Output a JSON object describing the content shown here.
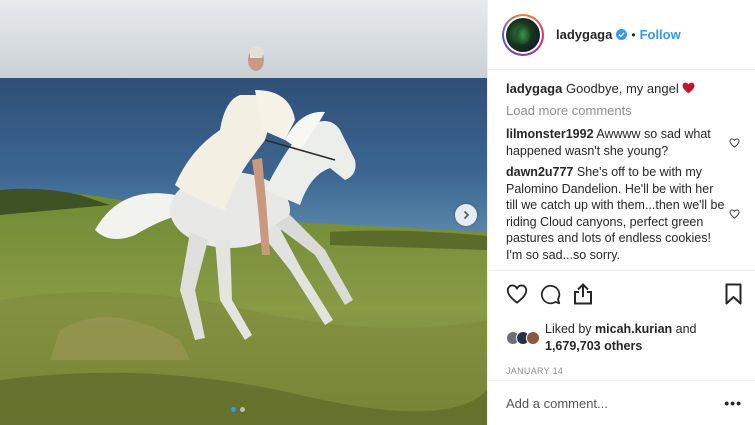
{
  "post": {
    "username": "ladygaga",
    "follow_label": "Follow",
    "separator": "•",
    "caption_user": "ladygaga",
    "caption_text": "Goodbye, my angel",
    "caption_emoji": "heart-emoji",
    "load_more": "Load more comments",
    "comments": [
      {
        "user": "lilmonster1992",
        "text": "Awwww so sad what happened wasn't she young?"
      },
      {
        "user": "dawn2u777",
        "text": "She's off to be with my Palomino Dandelion. He'll be with her till we catch up with them...then we'll be riding Cloud canyons, perfect green pastures and lots of endless cookies! I'm so sad...so sorry."
      }
    ],
    "likes_prefix": "Liked by",
    "likes_user": "micah.kurian",
    "likes_and": "and",
    "likes_count": "1,679,703 others",
    "date": "JANUARY 14",
    "add_comment_placeholder": "Add a comment...",
    "more_label": "•••",
    "icons": {
      "like": "heart-icon",
      "comment": "comment-icon",
      "share": "share-icon",
      "save": "bookmark-icon",
      "next": "chevron-right-icon"
    },
    "carousel": {
      "total": 2,
      "active_index": 0
    }
  },
  "colors": {
    "accent": "#3897f0",
    "text": "#262626",
    "muted": "#8e8e8e",
    "heart_emoji": "#ed4956"
  }
}
